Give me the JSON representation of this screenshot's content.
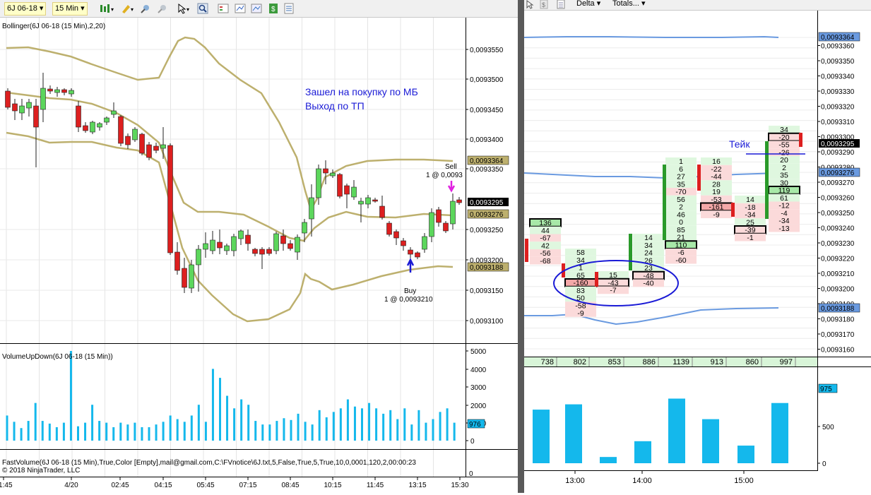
{
  "toolbar": {
    "instrument": "6J 06-18",
    "interval": "15 Min",
    "right_combo_1": "Delta",
    "right_combo_2": "Totals..."
  },
  "main_chart": {
    "indicator_label": "Bollinger(6J 06-18 (15 Min),2,20)",
    "price_labels": [
      "0,0093550",
      "0,0093500",
      "0,0093450",
      "0,0093400",
      "0,0093350",
      "0,0093250",
      "0,0093200",
      "0,0093150",
      "0,0093100"
    ],
    "marker_upper_band": "0,0093364",
    "marker_last": "0,0093295",
    "marker_middle": "0,0093276",
    "marker_lower_band": "0,0093188",
    "annotation_line1": "Зашел на покупку по МБ",
    "annotation_line2": "Выход по ТП",
    "sell_label": "Sell",
    "sell_price": "1 @ 0,0093",
    "buy_label": "Buy",
    "buy_price": "1 @ 0,0093210"
  },
  "volume_panel": {
    "label": "VolumeUpDown(6J 06-18 (15 Min))",
    "axis_labels": [
      "5000",
      "4000",
      "3000",
      "2000",
      "1000",
      "0"
    ],
    "last_value": "976"
  },
  "fastvolume_panel": {
    "label": "FastVolume(6J 06-18 (15 Min),True,Color [Empty],mail@gmail.com,C:\\FVnotice\\6J.txt,5,False,True,5,True,10,0,0001,120,2,00:00:23",
    "copyright": "© 2018 NinjaTrader, LLC",
    "axis_label": "0"
  },
  "time_axis_left": [
    "21:45",
    "4/20",
    "02:45",
    "04:15",
    "05:45",
    "07:15",
    "08:45",
    "10:15",
    "11:45",
    "13:15",
    "15:30"
  ],
  "right_chart": {
    "price_labels": [
      "0,0093360",
      "0,0093350",
      "0,0093340",
      "0,0093330",
      "0,0093320",
      "0,0093310",
      "0,0093300",
      "0,0093290",
      "0,0093280",
      "0,0093270",
      "0,0093260",
      "0,0093250",
      "0,0093240",
      "0,0093230",
      "0,0093220",
      "0,0093210",
      "0,0093200",
      "0,0093190",
      "0,0093180",
      "0,0093170",
      "0,0093160"
    ],
    "marker_upper": "0,0093364",
    "marker_last": "0,0093295",
    "marker_mid": "0,0093276",
    "marker_lower": "0,0093188",
    "take_label": "Тейк",
    "totals": [
      "738",
      "802",
      "853",
      "886",
      "1139",
      "913",
      "860",
      "997"
    ],
    "volume_axis": [
      "500",
      "0"
    ],
    "volume_last": "975",
    "time_labels": [
      "13:00",
      "14:00",
      "15:00"
    ],
    "col0": [
      "136",
      "44",
      "-67",
      "42",
      "-56",
      "-68"
    ],
    "col1": [
      "58",
      "34",
      "1",
      "65",
      "-160",
      "83",
      "50",
      "-58",
      "-9"
    ],
    "col2": [
      "15",
      "-43",
      "-7"
    ],
    "col3": [
      "14",
      "34",
      "24",
      "26",
      "23",
      "-48",
      "-40"
    ],
    "col4": [
      "1",
      "6",
      "27",
      "35",
      "-70",
      "56",
      "2",
      "46",
      "0",
      "85",
      "21",
      "110",
      "-6",
      "-60"
    ],
    "col5": [
      "16",
      "-22",
      "-44",
      "28",
      "19",
      "-53",
      "-161",
      "-9"
    ],
    "col6": [
      "14",
      "-18",
      "-34",
      "25",
      "-39",
      "-1"
    ],
    "col7": [
      "34",
      "-20",
      "-55",
      "-26",
      "20",
      "2",
      "35",
      "30",
      "119",
      "61",
      "-12",
      "-4",
      "-34",
      "-13"
    ]
  },
  "colors": {
    "band": "#bdb06e",
    "candle_up": "#5cd65c",
    "candle_down": "#dd1f1f",
    "volume_bar": "#14b8ec",
    "annotation": "#1a1ad6",
    "marker_dark": "#000000",
    "marker_blue": "#2d6ad6"
  }
}
